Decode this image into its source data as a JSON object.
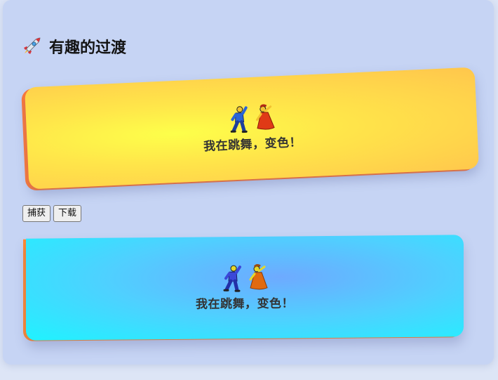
{
  "heading": {
    "icon": "rocket-icon",
    "title": "有趣的过渡"
  },
  "card_top": {
    "icons": [
      "man-dancing-icon",
      "woman-dancing-icon"
    ],
    "label": "我在跳舞，变色！",
    "colors": {
      "center": "#fdff4a",
      "outer": "#ffc64c",
      "edge": "#ff7b3a"
    }
  },
  "buttons": {
    "capture": "捕获",
    "download": "下载"
  },
  "card_bottom": {
    "icons": [
      "man-dancing-icon",
      "woman-dancing-icon"
    ],
    "label": "我在跳舞，变色！",
    "colors": {
      "center": "#6eaaff",
      "outer": "#1ff3ff",
      "edge": "#ff8a32"
    }
  }
}
